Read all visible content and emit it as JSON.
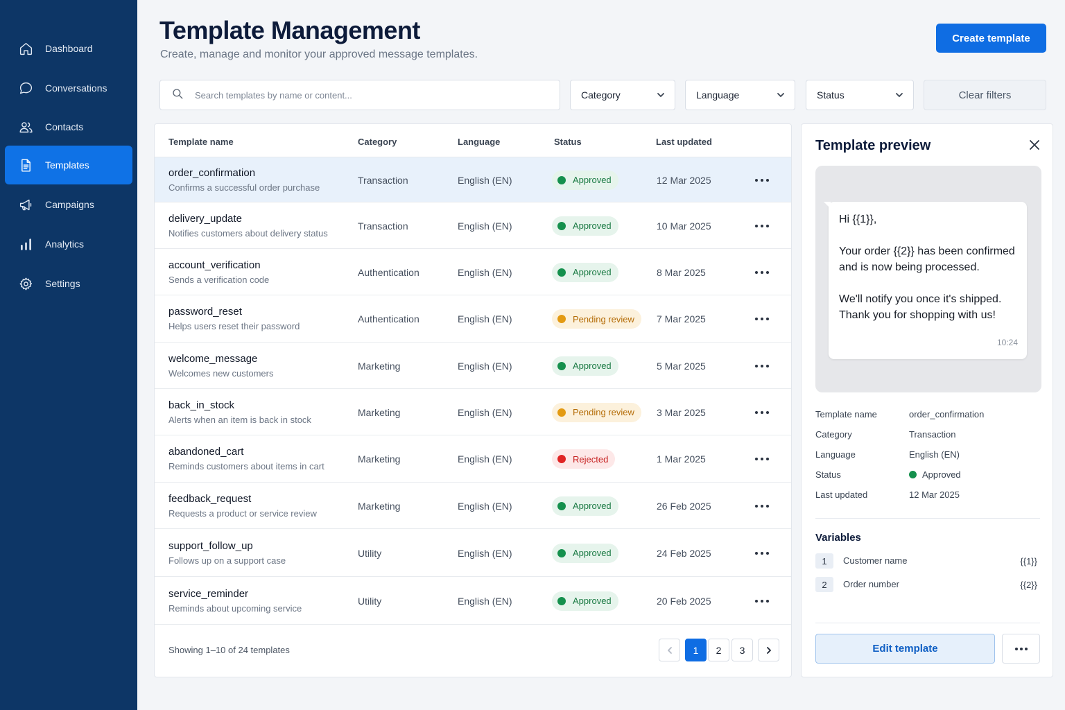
{
  "sidebar": {
    "items": [
      {
        "label": "Dashboard",
        "icon": "home-icon"
      },
      {
        "label": "Conversations",
        "icon": "chat-bubble-icon"
      },
      {
        "label": "Contacts",
        "icon": "users-icon"
      },
      {
        "label": "Templates",
        "icon": "document-icon",
        "active": true
      },
      {
        "label": "Campaigns",
        "icon": "megaphone-icon"
      },
      {
        "label": "Analytics",
        "icon": "bar-chart-icon"
      },
      {
        "label": "Settings",
        "icon": "gear-icon"
      }
    ]
  },
  "header": {
    "title": "Template Management",
    "subtitle": "Create, manage and monitor your approved message templates.",
    "create_label": "Create template"
  },
  "filters": {
    "search_placeholder": "Search templates by name or content...",
    "category": "Category",
    "language": "Language",
    "status": "Status",
    "clear_label": "Clear filters"
  },
  "table": {
    "columns": [
      "Template name",
      "Category",
      "Language",
      "Status",
      "Last updated"
    ],
    "rows": [
      {
        "name": "order_confirmation",
        "desc": "Confirms a successful order purchase",
        "category": "Transaction",
        "language": "English (EN)",
        "status": "Approved",
        "updated": "12 Mar 2025"
      },
      {
        "name": "delivery_update",
        "desc": "Notifies customers about delivery status",
        "category": "Transaction",
        "language": "English (EN)",
        "status": "Approved",
        "updated": "10 Mar 2025"
      },
      {
        "name": "account_verification",
        "desc": "Sends a verification code",
        "category": "Authentication",
        "language": "English (EN)",
        "status": "Approved",
        "updated": "8 Mar 2025"
      },
      {
        "name": "password_reset",
        "desc": "Helps users reset their password",
        "category": "Authentication",
        "language": "English (EN)",
        "status": "Pending review",
        "updated": "7 Mar 2025"
      },
      {
        "name": "welcome_message",
        "desc": "Welcomes new customers",
        "category": "Marketing",
        "language": "English (EN)",
        "status": "Approved",
        "updated": "5 Mar 2025"
      },
      {
        "name": "back_in_stock",
        "desc": "Alerts when an item is back in stock",
        "category": "Marketing",
        "language": "English (EN)",
        "status": "Pending review",
        "updated": "3 Mar 2025"
      },
      {
        "name": "abandoned_cart",
        "desc": "Reminds customers about items in cart",
        "category": "Marketing",
        "language": "English (EN)",
        "status": "Rejected",
        "updated": "1 Mar 2025"
      },
      {
        "name": "feedback_request",
        "desc": "Requests a product or service review",
        "category": "Marketing",
        "language": "English (EN)",
        "status": "Approved",
        "updated": "26 Feb 2025"
      },
      {
        "name": "support_follow_up",
        "desc": "Follows up on a support case",
        "category": "Utility",
        "language": "English (EN)",
        "status": "Approved",
        "updated": "24 Feb 2025"
      },
      {
        "name": "service_reminder",
        "desc": "Reminds about upcoming service",
        "category": "Utility",
        "language": "English (EN)",
        "status": "Approved",
        "updated": "20 Feb 2025"
      }
    ],
    "footer": "Showing 1–10 of 24 templates",
    "pages": [
      "1",
      "2",
      "3"
    ],
    "current_page": "1"
  },
  "preview": {
    "title": "Template preview",
    "message": {
      "greeting": "Hi {{1}},",
      "line1": "Your order {{2}} has been confirmed and is now being processed.",
      "line2": "We'll notify you once it's shipped. Thank you for shopping with us!",
      "time": "10:24"
    },
    "details": [
      {
        "label": "Template name",
        "value": "order_confirmation"
      },
      {
        "label": "Category",
        "value": "Transaction"
      },
      {
        "label": "Language",
        "value": "English (EN)"
      },
      {
        "label": "Status",
        "value": "Approved"
      },
      {
        "label": "Last updated",
        "value": "12 Mar 2025"
      }
    ],
    "variables_title": "Variables",
    "variables": [
      {
        "num": "1",
        "name": "Customer name",
        "token": "{{1}}"
      },
      {
        "num": "2",
        "name": "Order number",
        "token": "{{2}}"
      }
    ],
    "edit_label": "Edit template"
  },
  "colors": {
    "sidebar": "#0d3666",
    "accent": "#0f6de3",
    "approved": "#15904d",
    "pending": "#e39a12",
    "rejected": "#e02424"
  }
}
